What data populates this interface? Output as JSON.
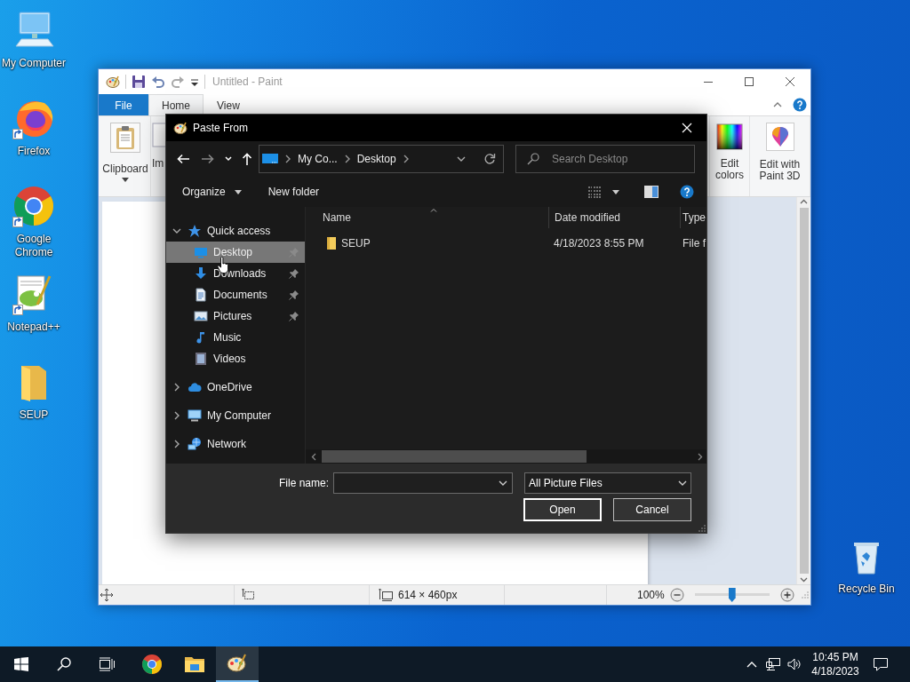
{
  "desktop_icons": [
    {
      "label": "My Computer",
      "kind": "computer",
      "shortcut": false,
      "selected": false
    },
    {
      "label": "Firefox",
      "kind": "firefox",
      "shortcut": true,
      "selected": false
    },
    {
      "label": "Google Chrome",
      "kind": "chrome",
      "shortcut": true,
      "selected": false
    },
    {
      "label": "Notepad++",
      "kind": "notepad",
      "shortcut": true,
      "selected": false
    },
    {
      "label": "SEUP",
      "kind": "folder",
      "shortcut": false,
      "selected": false
    }
  ],
  "recycle_bin": {
    "label": "Recycle Bin",
    "shortcut": false,
    "selected": false
  },
  "paint": {
    "title": "Untitled - Paint",
    "tabs": [
      {
        "label": "File",
        "kind": "file",
        "selected": false
      },
      {
        "label": "Home",
        "kind": "tab",
        "selected": true
      },
      {
        "label": "View",
        "kind": "tab",
        "selected": false
      }
    ],
    "ribbon_groups": [
      {
        "label": "Clipboard",
        "kind": "clipboard",
        "dropdown": true
      },
      {
        "label": "Im",
        "kind": "image",
        "dropdown": false
      },
      {
        "label": "Edit colors",
        "kind": "colors",
        "dropdown": false
      },
      {
        "label": "Edit with Paint 3D",
        "kind": "paint3d",
        "dropdown": false
      }
    ],
    "status_bar": {
      "image_size": "614 × 460px",
      "zoom": "100%",
      "zoom_slider": {
        "level": 0.5
      }
    }
  },
  "dialog": {
    "title": "Paste From",
    "breadcrumb": [
      "My Co...",
      "Desktop"
    ],
    "search": {
      "placeholder": "Search Desktop"
    },
    "toolbar": [
      {
        "label": "Organize",
        "dropdown": true
      },
      {
        "label": "New folder",
        "dropdown": false
      }
    ],
    "nav_pane": [
      {
        "label": "Quick access",
        "kind": "star",
        "expanded": true,
        "selected": false,
        "children": [
          {
            "label": "Desktop",
            "kind": "desktop",
            "selected": true,
            "pinned": true
          },
          {
            "label": "Downloads",
            "kind": "download",
            "selected": false,
            "pinned": true
          },
          {
            "label": "Documents",
            "kind": "document",
            "selected": false,
            "pinned": true
          },
          {
            "label": "Pictures",
            "kind": "pictures",
            "selected": false,
            "pinned": true
          },
          {
            "label": "Music",
            "kind": "music",
            "selected": false,
            "pinned": false
          },
          {
            "label": "Videos",
            "kind": "videos",
            "selected": false,
            "pinned": false
          }
        ]
      },
      {
        "label": "OneDrive",
        "kind": "cloud",
        "expanded": false,
        "selected": false
      },
      {
        "label": "My Computer",
        "kind": "computer",
        "expanded": false,
        "selected": false
      },
      {
        "label": "Network",
        "kind": "network",
        "expanded": false,
        "selected": false
      }
    ],
    "columns": [
      "Name",
      "Date modified",
      "Type"
    ],
    "rows": [
      {
        "name": "SEUP",
        "date_modified": "4/18/2023 8:55 PM",
        "type": "File f",
        "selected": false
      }
    ],
    "file_name_label": "File name:",
    "file_type": "All Picture Files",
    "buttons": [
      {
        "label": "Open",
        "default": true
      },
      {
        "label": "Cancel",
        "default": false
      }
    ]
  },
  "taskbar": {
    "apps": [
      {
        "kind": "chrome",
        "active": false
      },
      {
        "kind": "explorer",
        "active": false
      },
      {
        "kind": "paint",
        "active": true
      }
    ],
    "time": "10:45 PM",
    "date": "4/18/2023"
  }
}
